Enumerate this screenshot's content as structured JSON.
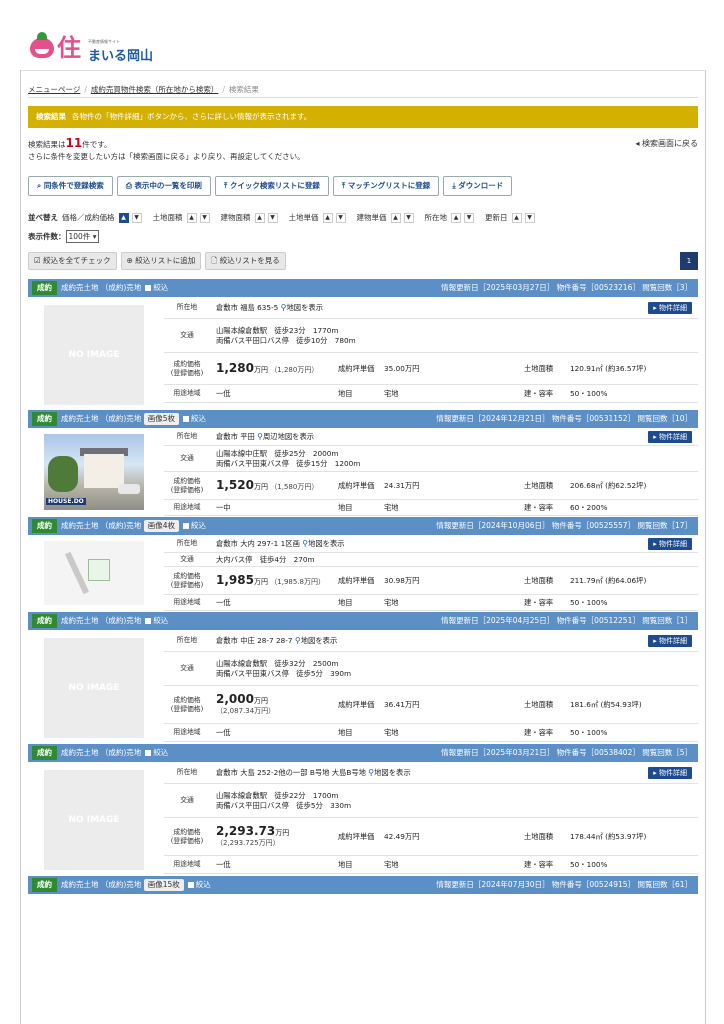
{
  "site": {
    "kanji": "住",
    "name": "まいる岡山",
    "sub": "不動産情報サイト"
  },
  "breadcrumb": {
    "home": "メニューページ",
    "search": "成約売買物件検索（所在地から検索）",
    "current": "検索結果"
  },
  "banner": {
    "title": "検索結果",
    "text": "各物件の「物件詳細」ボタンから、さらに詳しい情報が表示されます。"
  },
  "result": {
    "prefix": "検索結果は",
    "count": "11",
    "suffix": "件です。",
    "note": "さらに条件を変更したい方は「検索画面に戻る」より戻り、再設定してください。",
    "back": "◂ 検索画面に戻る"
  },
  "buttons": {
    "save": "同条件で登録検索",
    "print": "表示中の一覧を印刷",
    "quick": "クイック検索リストに登録",
    "matching": "マッチングリストに登録",
    "download": "ダウンロード"
  },
  "sort": {
    "label": "並べ替え",
    "items": [
      "価格／成約価格",
      "土地面積",
      "建物面積",
      "土地単価",
      "建物単価",
      "所在地",
      "更新日"
    ]
  },
  "perpage": {
    "label": "表示件数：",
    "value": "100件 ▾"
  },
  "tools": {
    "checkall": "☑ 絞込を全てチェック",
    "addlist": "⊕ 絞込リストに追加",
    "viewlist": "🗋 絞込リストを見る"
  },
  "pagination": {
    "current": "1"
  },
  "labels": {
    "badge": "成約",
    "type": "成約売土地 （成約)売地",
    "narrow": "絞込",
    "location": "所在地",
    "transport": "交通",
    "price_h1": "成約価格",
    "price_h2": "(登録価格)",
    "tsubo": "成約坪単価",
    "land_area": "土地面積",
    "zoning": "用途地域",
    "chimoku": "地目",
    "ratio": "建・容率",
    "detail": "▸ 物件詳細",
    "no_image": "NO IMAGE",
    "photo_brand": "HOUSE.DO"
  },
  "listings": [
    {
      "meta": "情報更新日［2025年03月27日］ 物件番号［00523216］ 閲覧回数［3］",
      "images": "",
      "location": "倉敷市 福島 635-5",
      "map": "地図を表示",
      "transport1": "山陽本線倉敷駅　徒歩23分　1770m",
      "transport2": "両備バス平田口バス停　徒歩10分　780m",
      "price": "1,280",
      "price_unit": "万円",
      "price_reg": "（1,280万円）",
      "tsubo": "35.00万円",
      "land_area": "120.91㎡ (約36.57坪)",
      "zoning": "一低",
      "chimoku": "宅地",
      "ratio": "50・100%"
    },
    {
      "meta": "情報更新日［2024年12月21日］ 物件番号［00531152］ 閲覧回数［10］",
      "images": "画像5枚",
      "location": "倉敷市 平田",
      "map": "周辺地図を表示",
      "transport1": "山陽本線中庄駅　徒歩25分　2000m",
      "transport2": "両備バス平田東バス停　徒歩15分　1200m",
      "price": "1,520",
      "price_unit": "万円",
      "price_reg": "（1,580万円）",
      "tsubo": "24.31万円",
      "land_area": "206.68㎡ (約62.52坪)",
      "zoning": "一中",
      "chimoku": "宅地",
      "ratio": "60・200%"
    },
    {
      "meta": "情報更新日［2024年10月06日］ 物件番号［00525557］ 閲覧回数［17］",
      "images": "画像4枚",
      "location": "倉敷市 大内 297-1 1区画",
      "map": "地図を表示",
      "transport1": "大内バス停　徒歩4分　270m",
      "transport2": "",
      "price": "1,985",
      "price_unit": "万円",
      "price_reg": "（1,985.8万円）",
      "tsubo": "30.98万円",
      "land_area": "211.79㎡ (約64.06坪)",
      "zoning": "一低",
      "chimoku": "宅地",
      "ratio": "50・100%"
    },
    {
      "meta": "情報更新日［2025年04月25日］ 物件番号［00512251］ 閲覧回数［1］",
      "images": "",
      "location": "倉敷市 中庄 28-7 28-7",
      "map": "地図を表示",
      "transport1": "山陽本線倉敷駅　徒歩32分　2500m",
      "transport2": "両備バス平田東バス停　徒歩5分　390m",
      "price": "2,000",
      "price_unit": "万円",
      "price_reg": "（2,087.34万円）",
      "tsubo": "36.41万円",
      "land_area": "181.6㎡ (約54.93坪)",
      "zoning": "一低",
      "chimoku": "宅地",
      "ratio": "50・100%"
    },
    {
      "meta": "情報更新日［2025年03月21日］ 物件番号［00538402］ 閲覧回数［5］",
      "images": "",
      "location": "倉敷市 大島 252-2他の一部 B号地 大島B号地",
      "map": "地図を表示",
      "transport1": "山陽本線倉敷駅　徒歩22分　1700m",
      "transport2": "両備バス平田口バス停　徒歩5分　330m",
      "price": "2,293.73",
      "price_unit": "万円",
      "price_reg": "（2,293.725万円）",
      "tsubo": "42.49万円",
      "land_area": "178.44㎡ (約53.97坪)",
      "zoning": "一低",
      "chimoku": "宅地",
      "ratio": "50・100%"
    },
    {
      "meta": "情報更新日［2024年07月30日］ 物件番号［00524915］ 閲覧回数［61］",
      "images": "画像15枚"
    }
  ]
}
